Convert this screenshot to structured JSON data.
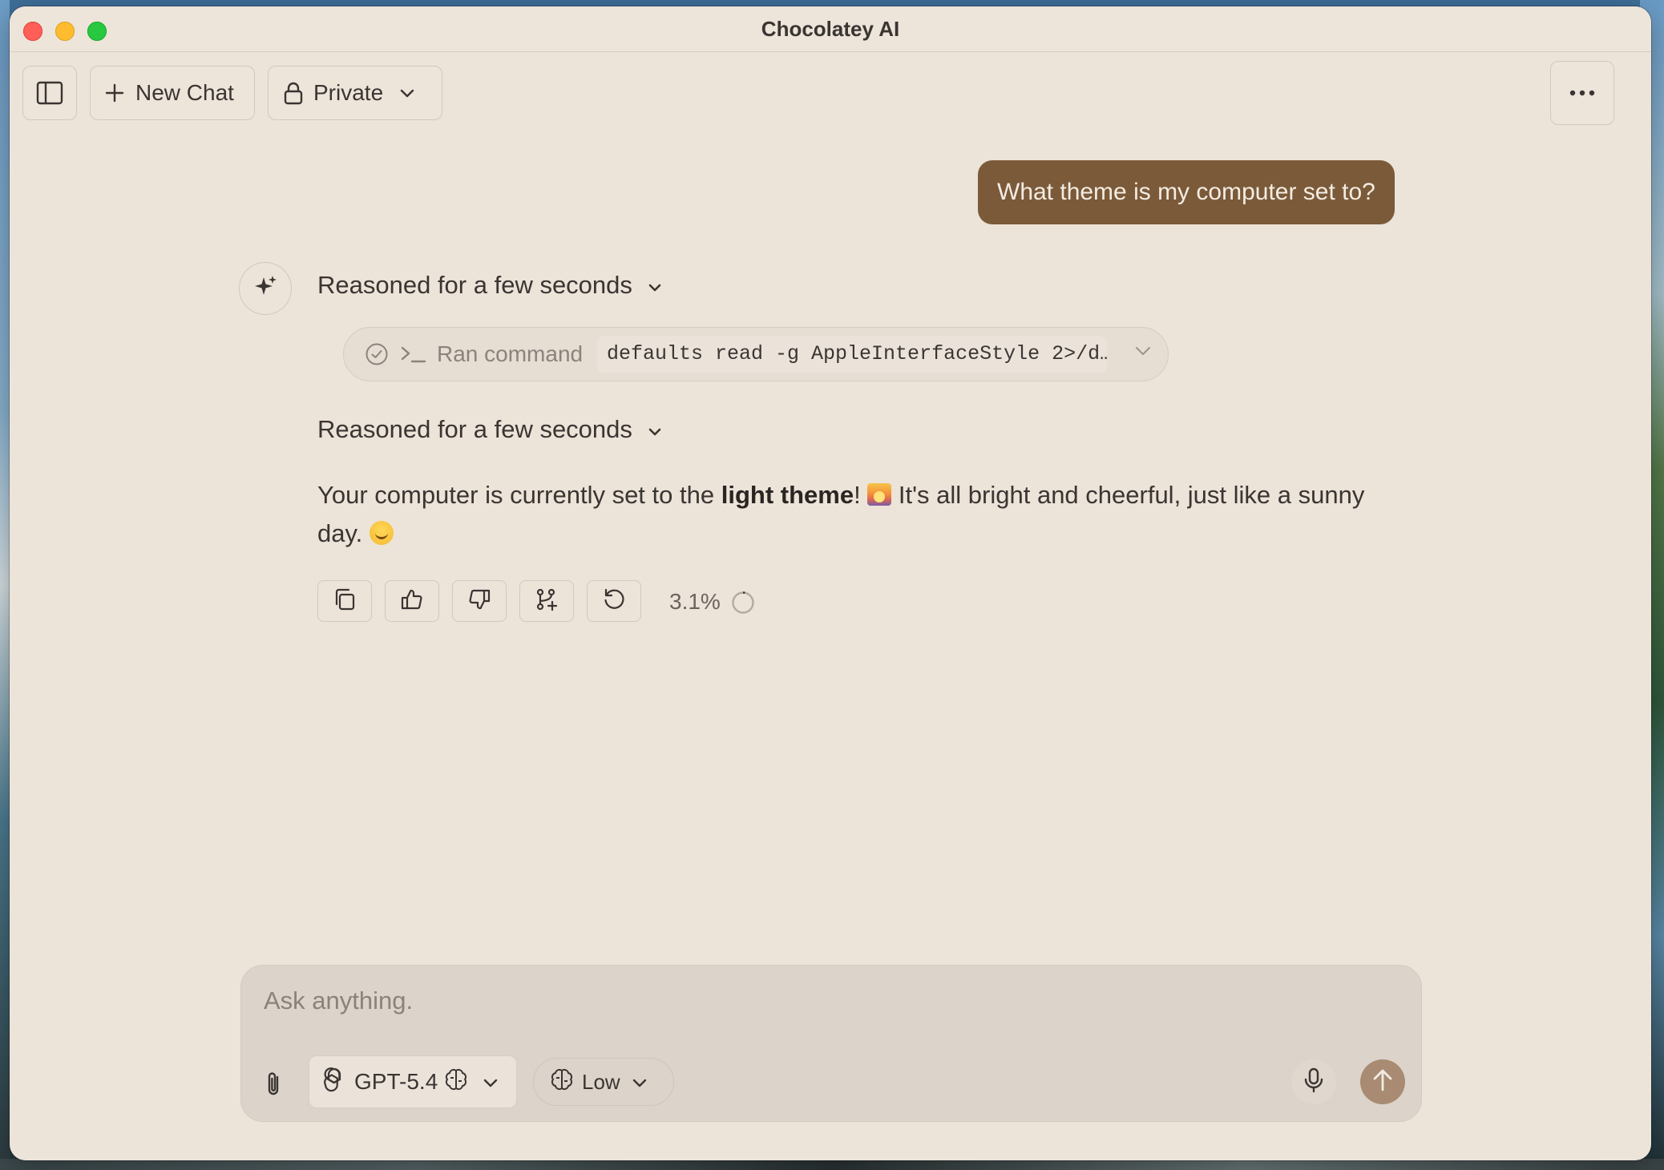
{
  "window": {
    "title": "Chocolatey AI"
  },
  "toolbar": {
    "new_chat_label": "New Chat",
    "privacy_label": "Private"
  },
  "conversation": {
    "user_message": "What theme is my computer set to?",
    "reasoning_1": "Reasoned for a few seconds",
    "tool_call": {
      "label": "Ran command",
      "command": "defaults read -g AppleInterfaceStyle 2>/d…"
    },
    "reasoning_2": "Reasoned for a few seconds",
    "answer": {
      "part1": "Your computer is currently set to the ",
      "bold": "light theme",
      "part2": "! ",
      "part3": " It's all bright and cheerful, just like a sunny day. "
    },
    "context_usage": "3.1%"
  },
  "composer": {
    "placeholder": "Ask anything.",
    "model": "GPT-5.4",
    "effort": "Low"
  },
  "colors": {
    "user_bubble": "#7b5a3a",
    "send_button": "#a88b72",
    "window_bg": "#ece3d9"
  },
  "icons": {
    "sidebar": "sidebar-toggle-icon",
    "new_chat": "plus-icon",
    "private": "lock-icon",
    "more": "ellipsis-icon",
    "assistant": "sparkle-icon",
    "copy": "copy-icon",
    "like": "thumbs-up-icon",
    "dislike": "thumbs-down-icon",
    "branch": "branch-icon",
    "retry": "retry-icon",
    "attach": "paperclip-icon",
    "model": "openai-icon",
    "reasoning": "brain-icon",
    "mic": "microphone-icon",
    "send": "arrow-up-icon"
  }
}
